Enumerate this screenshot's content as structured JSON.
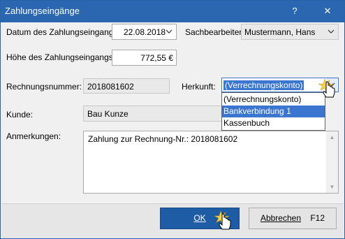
{
  "window": {
    "title": "Zahlungseingänge",
    "help_glyph": "?",
    "close_glyph": "✕"
  },
  "form": {
    "date_label": "Datum des Zahlungseingangs:",
    "date_value": "22.08.2018",
    "clerk_label": "Sachbearbeiter:",
    "clerk_value": "Mustermann, Hans",
    "amount_label": "Höhe des Zahlungseingangs:",
    "amount_value": "772,55 €",
    "invoice_label": "Rechnungsnummer:",
    "invoice_value": "2018081602",
    "origin_label": "Herkunft:",
    "origin_value": "(Verrechnungskonto)",
    "origin_options": [
      "(Verrechnungskonto)",
      "Bankverbindung 1",
      "Kassenbuch"
    ],
    "origin_highlighted": "Bankverbindung 1",
    "customer_label": "Kunde:",
    "customer_value": "Bau Kunze",
    "notes_label": "Anmerkungen:",
    "notes_value": "Zahlung zur Rechnung-Nr.: 2018081602"
  },
  "footer": {
    "ok_label": "OK",
    "cancel_label": "Abbrechen",
    "cancel_shortcut": "F12"
  },
  "icons": {
    "dropdown_arrow": "chevron-down-icon",
    "pointer": "hand-pointer-icon"
  }
}
